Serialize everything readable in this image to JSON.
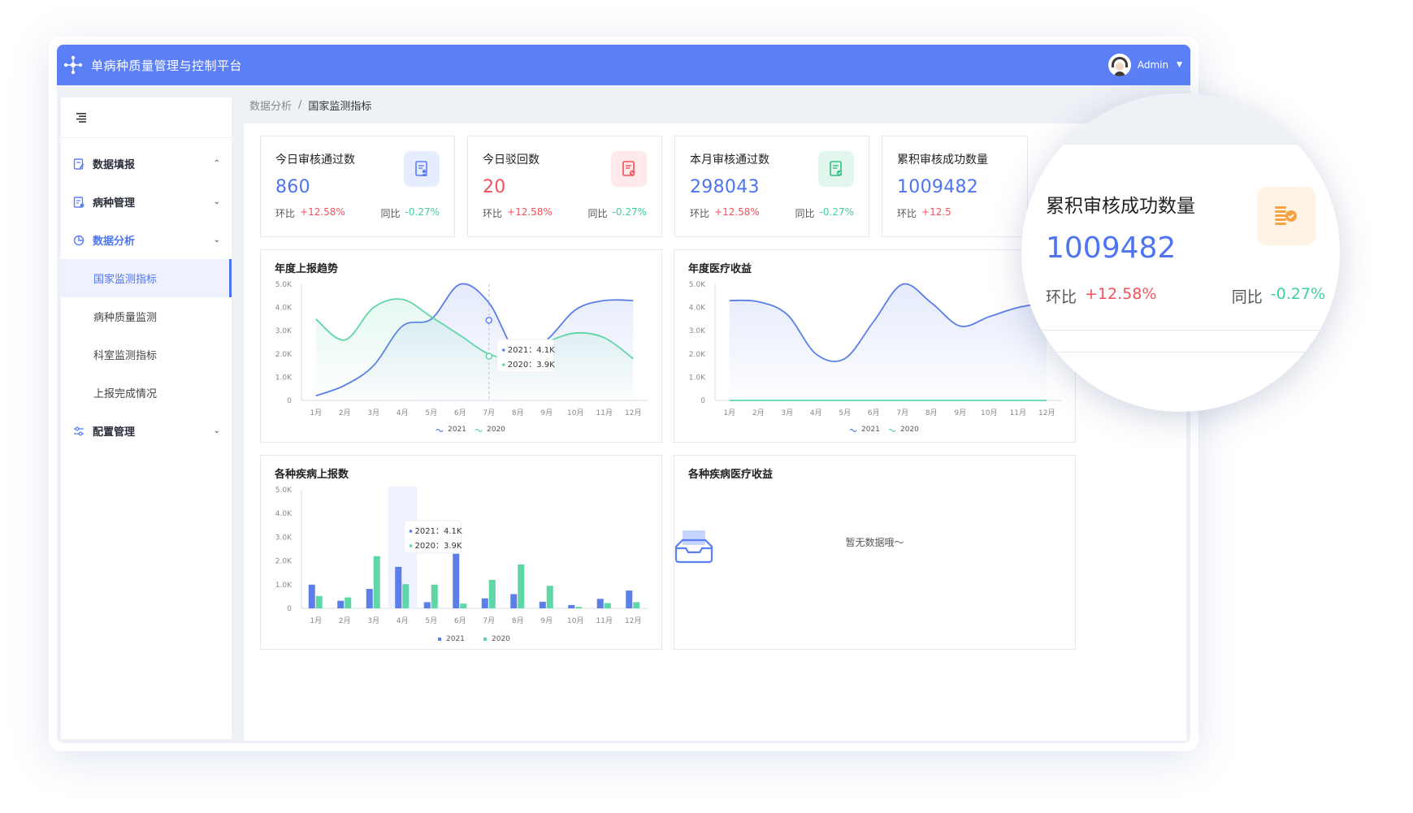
{
  "header": {
    "app_title": "单病种质量管理与控制平台",
    "user_name": "Admin"
  },
  "sidebar": {
    "items": [
      {
        "label": "数据填报",
        "caret": "⌃"
      },
      {
        "label": "病种管理",
        "caret": "⌄"
      },
      {
        "label": "数据分析",
        "caret": "⌄"
      },
      {
        "label": "配置管理",
        "caret": "⌄"
      }
    ],
    "sub_items": [
      {
        "label": "国家监测指标"
      },
      {
        "label": "病种质量监测"
      },
      {
        "label": "科室监测指标"
      },
      {
        "label": "上报完成情况"
      }
    ]
  },
  "breadcrumb": {
    "parent": "数据分析",
    "separator": "/",
    "current": "国家监测指标"
  },
  "stats": [
    {
      "title": "今日审核通过数",
      "value": "860",
      "mom_label": "环比",
      "mom": "+12.58%",
      "yoy_label": "同比",
      "yoy": "-0.27%",
      "value_color": "#4e74f0",
      "icon": "document-user-icon"
    },
    {
      "title": "今日驳回数",
      "value": "20",
      "mom_label": "环比",
      "mom": "+12.58%",
      "yoy_label": "同比",
      "yoy": "-0.27%",
      "value_color": "#f5505b",
      "icon": "document-reject-icon"
    },
    {
      "title": "本月审核通过数",
      "value": "298043",
      "mom_label": "环比",
      "mom": "+12.58%",
      "yoy_label": "同比",
      "yoy": "-0.27%",
      "value_color": "#4e74f0",
      "icon": "document-check-icon"
    },
    {
      "title": "累积审核成功数量",
      "value": "1009482",
      "mom_label": "环比",
      "mom": "+12.5",
      "yoy_label": "同比",
      "yoy": "-0.27%",
      "value_color": "#4e74f0",
      "icon": "coins-check-icon"
    }
  ],
  "magnifier": {
    "title": "累积审核成功数量",
    "value": "1009482",
    "mom_label": "环比",
    "mom": "+12.58%",
    "yoy_label": "同比",
    "yoy": "-0.27%"
  },
  "charts": {
    "trend_title": "年度上报趋势",
    "income_title": "年度医疗收益",
    "disease_title": "各种疾病上报数",
    "disease_income_title": "各种疾病医疗收益",
    "empty_text": "暂无数据哦～"
  },
  "colors": {
    "primary": "#5a7ff6",
    "series_2021": "#5b7ee8",
    "series_2020": "#5fd6a6",
    "up": "#f5505b",
    "down": "#3fcf9a"
  },
  "chart_data": [
    {
      "type": "area",
      "title": "年度上报趋势",
      "categories": [
        "1月",
        "2月",
        "3月",
        "4月",
        "5月",
        "6月",
        "7月",
        "8月",
        "9月",
        "10月",
        "11月",
        "12月"
      ],
      "y_ticks": [
        "0",
        "1.0K",
        "2.0K",
        "3.0K",
        "4.0K",
        "5.0K"
      ],
      "ylim": [
        0,
        5000
      ],
      "series": [
        {
          "name": "2021",
          "values": [
            200,
            650,
            1500,
            3200,
            3500,
            5000,
            4200,
            2000,
            2600,
            3900,
            4300,
            4300
          ]
        },
        {
          "name": "2020",
          "values": [
            3500,
            2600,
            4000,
            4350,
            3600,
            2800,
            2000,
            1800,
            2500,
            2900,
            2700,
            1800
          ]
        }
      ],
      "tooltip": {
        "category_index": 7,
        "lines": [
          "2021：4.1K",
          "2020：3.9K"
        ]
      },
      "legend": "bottom"
    },
    {
      "type": "area",
      "title": "年度医疗收益",
      "categories": [
        "1月",
        "2月",
        "3月",
        "4月",
        "5月",
        "6月",
        "7月",
        "8月",
        "9月",
        "10月",
        "11月",
        "12月"
      ],
      "y_ticks": [
        "0",
        "1.0K",
        "2.0K",
        "3.0K",
        "4.0K",
        "5.0K"
      ],
      "ylim": [
        0,
        5000
      ],
      "series": [
        {
          "name": "2021",
          "values": [
            4300,
            4250,
            3700,
            2000,
            1800,
            3400,
            5000,
            4200,
            3200,
            3600,
            4000,
            4200
          ]
        },
        {
          "name": "2020",
          "values": [
            0,
            0,
            0,
            0,
            0,
            0,
            0,
            0,
            0,
            0,
            0,
            0
          ]
        }
      ],
      "legend": "bottom"
    },
    {
      "type": "bar",
      "title": "各种疾病上报数",
      "categories": [
        "1月",
        "2月",
        "3月",
        "4月",
        "5月",
        "6月",
        "7月",
        "8月",
        "9月",
        "10月",
        "11月",
        "12月"
      ],
      "y_ticks": [
        "0",
        "1.0K",
        "2.0K",
        "3.0K",
        "4.0K",
        "5.0K"
      ],
      "ylim": [
        0,
        5000
      ],
      "series": [
        {
          "name": "2021",
          "values": [
            1000,
            320,
            820,
            1750,
            260,
            2300,
            420,
            600,
            280,
            140,
            400,
            750
          ]
        },
        {
          "name": "2020",
          "values": [
            520,
            460,
            2200,
            1020,
            1000,
            200,
            1200,
            1850,
            950,
            60,
            220,
            260
          ]
        }
      ],
      "tooltip": {
        "category_index": 3,
        "lines": [
          "2021：4.1K",
          "2020：3.9K"
        ]
      },
      "legend": "bottom"
    }
  ]
}
